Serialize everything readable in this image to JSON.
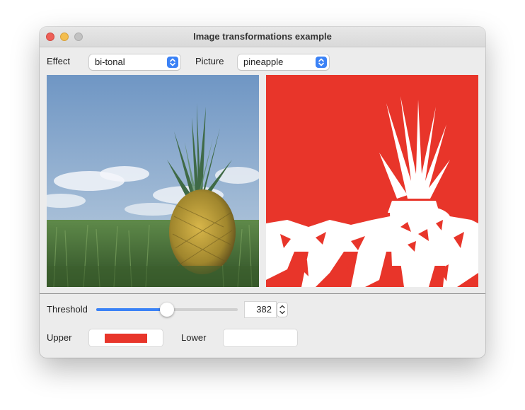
{
  "window": {
    "title": "Image transformations example"
  },
  "controls": {
    "effect_label": "Effect",
    "effect_value": "bi-tonal",
    "picture_label": "Picture",
    "picture_value": "pineapple",
    "threshold_label": "Threshold",
    "threshold_value": "382",
    "threshold_fraction": 0.5,
    "upper_label": "Upper",
    "upper_color": "#e8352a",
    "lower_label": "Lower",
    "lower_color": "#ffffff"
  },
  "icons": [
    "close-icon",
    "minimize-icon",
    "maximize-icon",
    "chevron-updown-icon",
    "stepper-icon"
  ],
  "colors": {
    "accent": "#3b82f6",
    "bitonal_red": "#e8352a",
    "sky": "#8fb0d2",
    "grass": "#4f7a3b"
  }
}
